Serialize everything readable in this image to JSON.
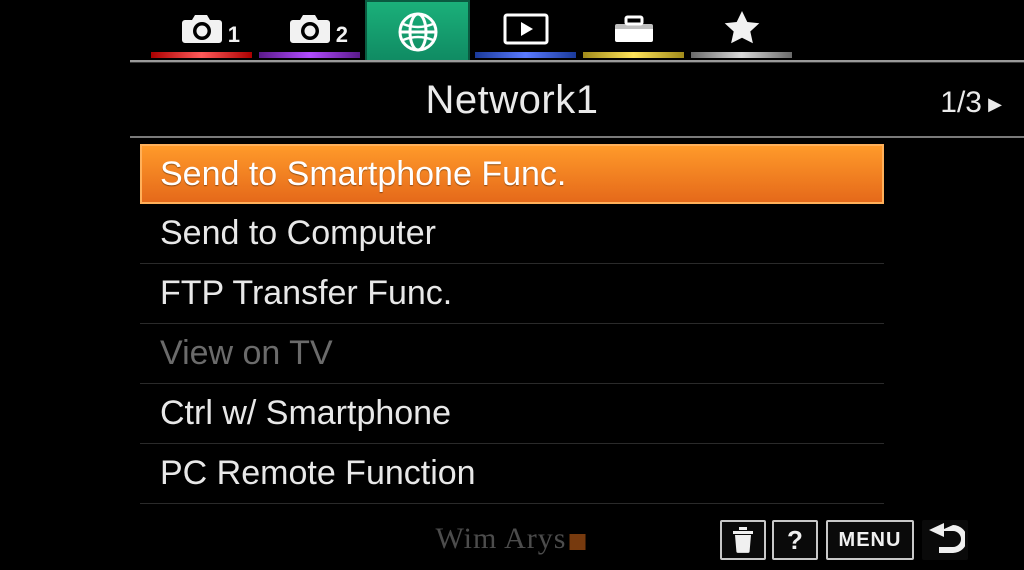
{
  "tabs": {
    "cam1_badge": "1",
    "cam2_badge": "2",
    "active_index": 2,
    "names": [
      "camera-1",
      "camera-2",
      "network",
      "playback",
      "toolbox",
      "favorites"
    ]
  },
  "header": {
    "title": "Network1",
    "page_current": "1",
    "page_total": "3",
    "page_display": "1/3"
  },
  "menu": {
    "items": [
      {
        "label": "Send to Smartphone Func.",
        "selected": true,
        "enabled": true
      },
      {
        "label": "Send to Computer",
        "selected": false,
        "enabled": true
      },
      {
        "label": "FTP Transfer Func.",
        "selected": false,
        "enabled": true
      },
      {
        "label": "View on TV",
        "selected": false,
        "enabled": false
      },
      {
        "label": "Ctrl w/ Smartphone",
        "selected": false,
        "enabled": true
      },
      {
        "label": "PC Remote Function",
        "selected": false,
        "enabled": true
      }
    ]
  },
  "footer": {
    "trash_icon": "trash-icon",
    "help_label": "?",
    "menu_label": "MENU",
    "back_icon": "back-arrow-icon"
  },
  "watermark": "Wim Arys",
  "colors": {
    "highlight": "#e5691a",
    "active_tab": "#0f8a62"
  }
}
